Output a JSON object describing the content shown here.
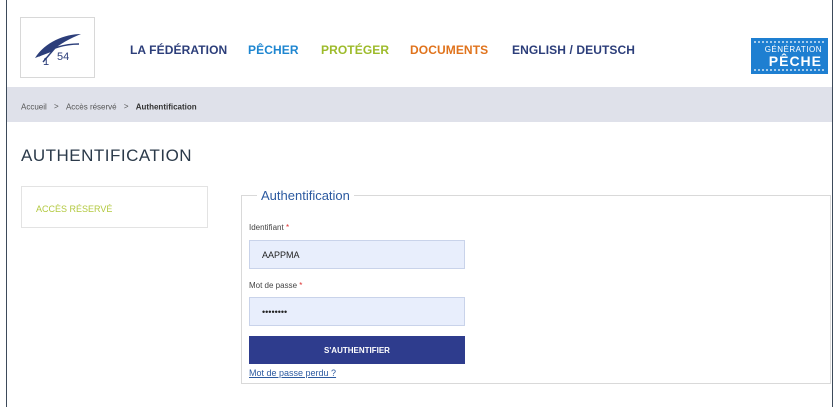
{
  "logo": {
    "text": "54",
    "icon": "fish-logo-icon"
  },
  "nav": [
    {
      "label": "LA FÉDÉRATION",
      "color": "#2c3e7a"
    },
    {
      "label": "PÊCHER",
      "color": "#1e86d0"
    },
    {
      "label": "PROTÉGER",
      "color": "#9dbb2b"
    },
    {
      "label": "DOCUMENTS",
      "color": "#e0731c"
    },
    {
      "label": "ENGLISH / DEUTSCH",
      "color": "#2c3e7a"
    }
  ],
  "badge": {
    "line1": "GÉNÉRATION",
    "line2": "PÊCHE",
    "color": "#1e7fd1"
  },
  "breadcrumb": {
    "home": "Accueil",
    "sep": ">",
    "section": "Accès réservé",
    "current": "Authentification"
  },
  "page": {
    "title": "AUTHENTIFICATION"
  },
  "sidebar": {
    "link": "ACCÈS RÉSERVÉ"
  },
  "form": {
    "legend": "Authentification",
    "id_label": "Identifiant",
    "id_value": "AAPPMA",
    "pw_label": "Mot de passe",
    "pw_value": "password",
    "required": "*",
    "submit": "S'AUTHENTIFIER",
    "lost": "Mot de passe perdu ?"
  }
}
